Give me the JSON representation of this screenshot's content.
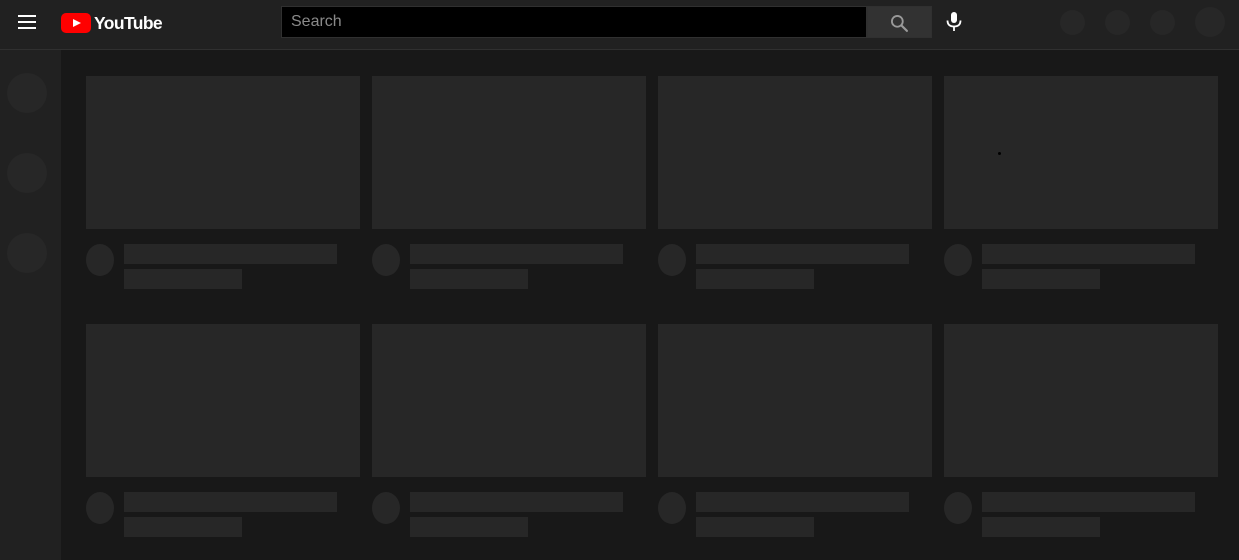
{
  "header": {
    "logo_text": "YouTube",
    "search_placeholder": "Search"
  },
  "colors": {
    "brand": "#ff0000",
    "background": "#181818",
    "header_background": "#212121",
    "placeholder": "#272727"
  },
  "icons": {
    "menu": "hamburger-menu-icon",
    "search": "search-icon",
    "mic": "microphone-icon"
  },
  "feed": {
    "rows": 2,
    "columns": 4,
    "state": "loading"
  }
}
